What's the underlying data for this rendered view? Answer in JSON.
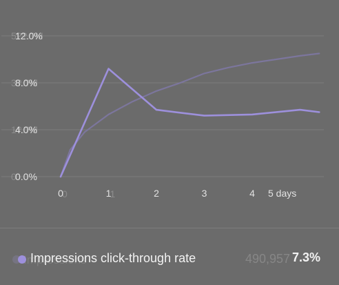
{
  "chart_data": {
    "type": "line",
    "x": [
      0,
      1,
      2,
      3,
      4,
      5
    ],
    "x_tick_labels": [
      "0",
      "1",
      "2",
      "3",
      "4",
      "5 days"
    ],
    "ylim": [
      0,
      12
    ],
    "y_ticks": [
      "0.0%",
      "4.0%",
      "8.0%",
      "12.0%"
    ],
    "grid": true,
    "series": [
      {
        "name": "Impressions click-through rate",
        "color": "#9d90dc",
        "x": [
          0,
          1,
          2,
          3,
          4,
          5,
          5.4
        ],
        "values": [
          0.0,
          9.2,
          5.7,
          5.2,
          5.3,
          5.7,
          5.5
        ]
      },
      {
        "name": "Impressions",
        "color": "#7f78a6",
        "x": [
          0,
          0.2,
          0.5,
          1,
          1.5,
          2,
          2.5,
          3,
          3.5,
          4,
          4.5,
          5,
          5.4
        ],
        "values": [
          0,
          2.3,
          3.8,
          5.3,
          6.4,
          7.3,
          8.0,
          8.8,
          9.3,
          9.7,
          10.0,
          10.3,
          10.5
        ]
      }
    ],
    "ghost_y_ticks": [
      "0",
      "1?.?M",
      "3?.?M",
      "5??.?M"
    ],
    "ghost_x_ticks": [
      "0",
      "1"
    ]
  },
  "legend": {
    "primary_label": "Impressions click-through rate",
    "primary_value": "7.3%",
    "ghost_label": "Impressions",
    "ghost_value": "490,957"
  }
}
